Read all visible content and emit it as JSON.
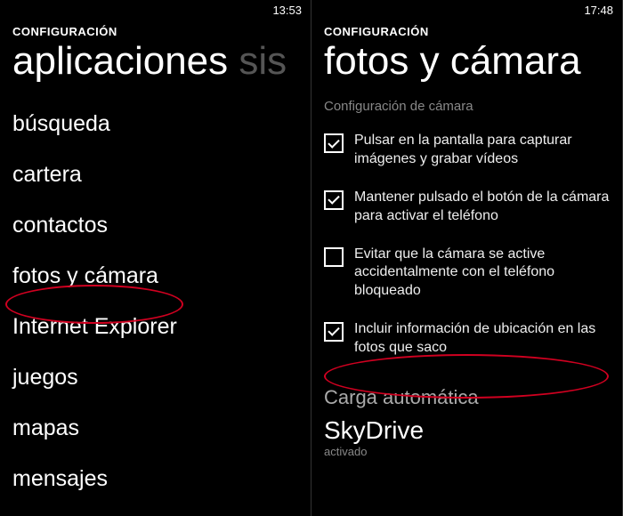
{
  "left": {
    "time": "13:53",
    "header_small": "CONFIGURACIÓN",
    "pivot_main": "aplicaciones",
    "pivot_secondary": " sis",
    "items": [
      "búsqueda",
      "cartera",
      "contactos",
      "fotos y cámara",
      "Internet Explorer",
      "juegos",
      "mapas",
      "mensajes"
    ]
  },
  "right": {
    "time": "17:48",
    "header_small": "CONFIGURACIÓN",
    "pivot_main": "fotos y cámara",
    "section_label": "Configuración de cámara",
    "options": [
      {
        "checked": true,
        "label": "Pulsar en la pantalla para capturar imágenes y grabar vídeos"
      },
      {
        "checked": true,
        "label": "Mantener pulsado el botón de la cámara para activar el teléfono"
      },
      {
        "checked": false,
        "label": "Evitar que la cámara se active accidentalmente con el teléfono bloqueado"
      },
      {
        "checked": true,
        "label": "Incluir información de ubicación en las fotos que saco"
      }
    ],
    "autoload_title": "Carga automática",
    "skydrive_title": "SkyDrive",
    "skydrive_state": "activado"
  }
}
